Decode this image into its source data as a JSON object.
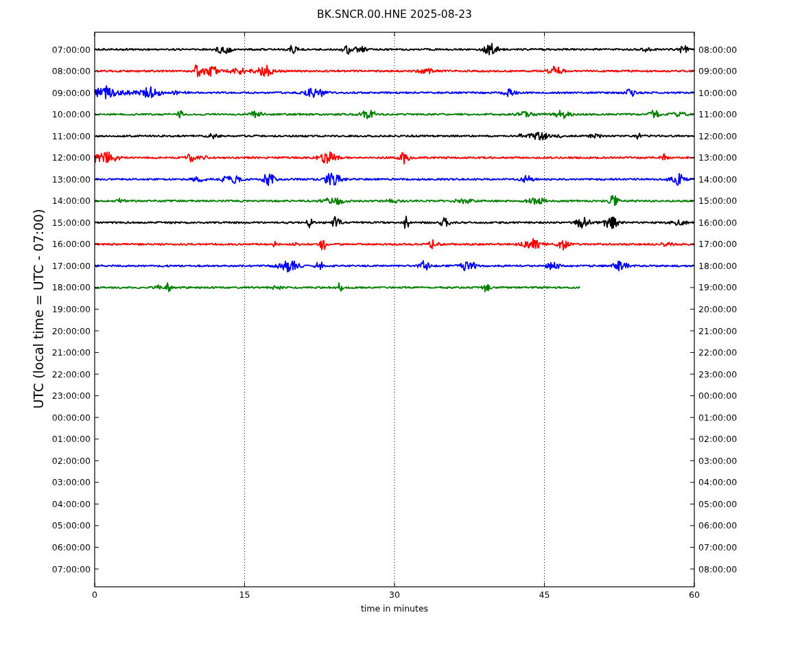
{
  "title": "BK.SNCR.00.HNE 2025-08-23",
  "y_axis_label": "UTC (local time = UTC - 07:00)",
  "x_axis_label": "time in minutes",
  "x_ticks": [
    "0",
    "15",
    "30",
    "45",
    "60"
  ],
  "left_labels": [
    "07:00:00",
    "08:00:00",
    "09:00:00",
    "10:00:00",
    "11:00:00",
    "12:00:00",
    "13:00:00",
    "14:00:00",
    "15:00:00",
    "16:00:00",
    "17:00:00",
    "18:00:00",
    "19:00:00",
    "20:00:00",
    "21:00:00",
    "22:00:00",
    "23:00:00",
    "00:00:00",
    "01:00:00",
    "02:00:00",
    "03:00:00",
    "04:00:00",
    "05:00:00",
    "06:00:00",
    "07:00:00"
  ],
  "right_labels": [
    "08:00:00",
    "09:00:00",
    "10:00:00",
    "11:00:00",
    "12:00:00",
    "13:00:00",
    "14:00:00",
    "15:00:00",
    "16:00:00",
    "17:00:00",
    "18:00:00",
    "19:00:00",
    "20:00:00",
    "21:00:00",
    "22:00:00",
    "23:00:00",
    "00:00:00",
    "01:00:00",
    "02:00:00",
    "03:00:00",
    "04:00:00",
    "05:00:00",
    "06:00:00",
    "07:00:00",
    "08:00:00"
  ],
  "traces": [
    {
      "color": "#000000",
      "level": 1
    },
    {
      "color": "#ff0000",
      "level": 1
    },
    {
      "color": "#0000ff",
      "level": 1
    },
    {
      "color": "#008000",
      "level": 1
    },
    {
      "color": "#000000",
      "level": 1
    },
    {
      "color": "#ff0000",
      "level": 1
    },
    {
      "color": "#0000ff",
      "level": 1
    },
    {
      "color": "#008000",
      "level": 1
    },
    {
      "color": "#000000",
      "level": 1
    },
    {
      "color": "#ff0000",
      "level": 1
    },
    {
      "color": "#0000ff",
      "level": 1
    },
    {
      "color": "#008000",
      "level": 0.81
    }
  ]
}
